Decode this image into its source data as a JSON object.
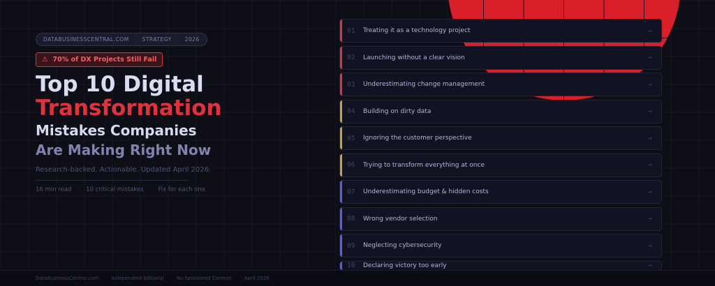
{
  "breadcrumb": {
    "site": "DATABUSINESSCENTRAL.COM",
    "category": "STRATEGY",
    "year": "2026"
  },
  "alert": {
    "icon": "warning-icon",
    "text": "70% of DX Projects Still Fail"
  },
  "title": {
    "line1": "Top 10 Digital",
    "line2": "Transformation",
    "line3": "Mistakes Companies",
    "line4": "Are Making Right Now"
  },
  "subtitle": "Research-backed. Actionable. Updated April 2026.",
  "meta": [
    "16 min read",
    "10 critical mistakes",
    "Fix for each one"
  ],
  "colors": {
    "red": "#e0323d",
    "amber": "#c9a23a",
    "indigo": "#5a5fd8"
  },
  "mistakes": [
    {
      "num": "01",
      "text": "Treating it as a technology project",
      "color": "#e0323d"
    },
    {
      "num": "02",
      "text": "Launching without a clear vision",
      "color": "#e0323d"
    },
    {
      "num": "03",
      "text": "Underestimating change management",
      "color": "#e0323d"
    },
    {
      "num": "04",
      "text": "Building on dirty data",
      "color": "#c9a23a"
    },
    {
      "num": "05",
      "text": "Ignoring the customer perspective",
      "color": "#c9a23a"
    },
    {
      "num": "06",
      "text": "Trying to transform everything at once",
      "color": "#c9a23a"
    },
    {
      "num": "07",
      "text": "Underestimating budget & hidden costs",
      "color": "#5a5fd8"
    },
    {
      "num": "08",
      "text": "Wrong vendor selection",
      "color": "#5a5fd8"
    },
    {
      "num": "09",
      "text": "Neglecting cybersecurity",
      "color": "#5a5fd8"
    },
    {
      "num": "10",
      "text": "Declaring victory too early",
      "color": "#5a5fd8"
    }
  ],
  "arrow": "→",
  "footer": [
    "DataBusinessCentral.com",
    "Independent Editorial",
    "No Sponsored Content",
    "April 2026"
  ]
}
